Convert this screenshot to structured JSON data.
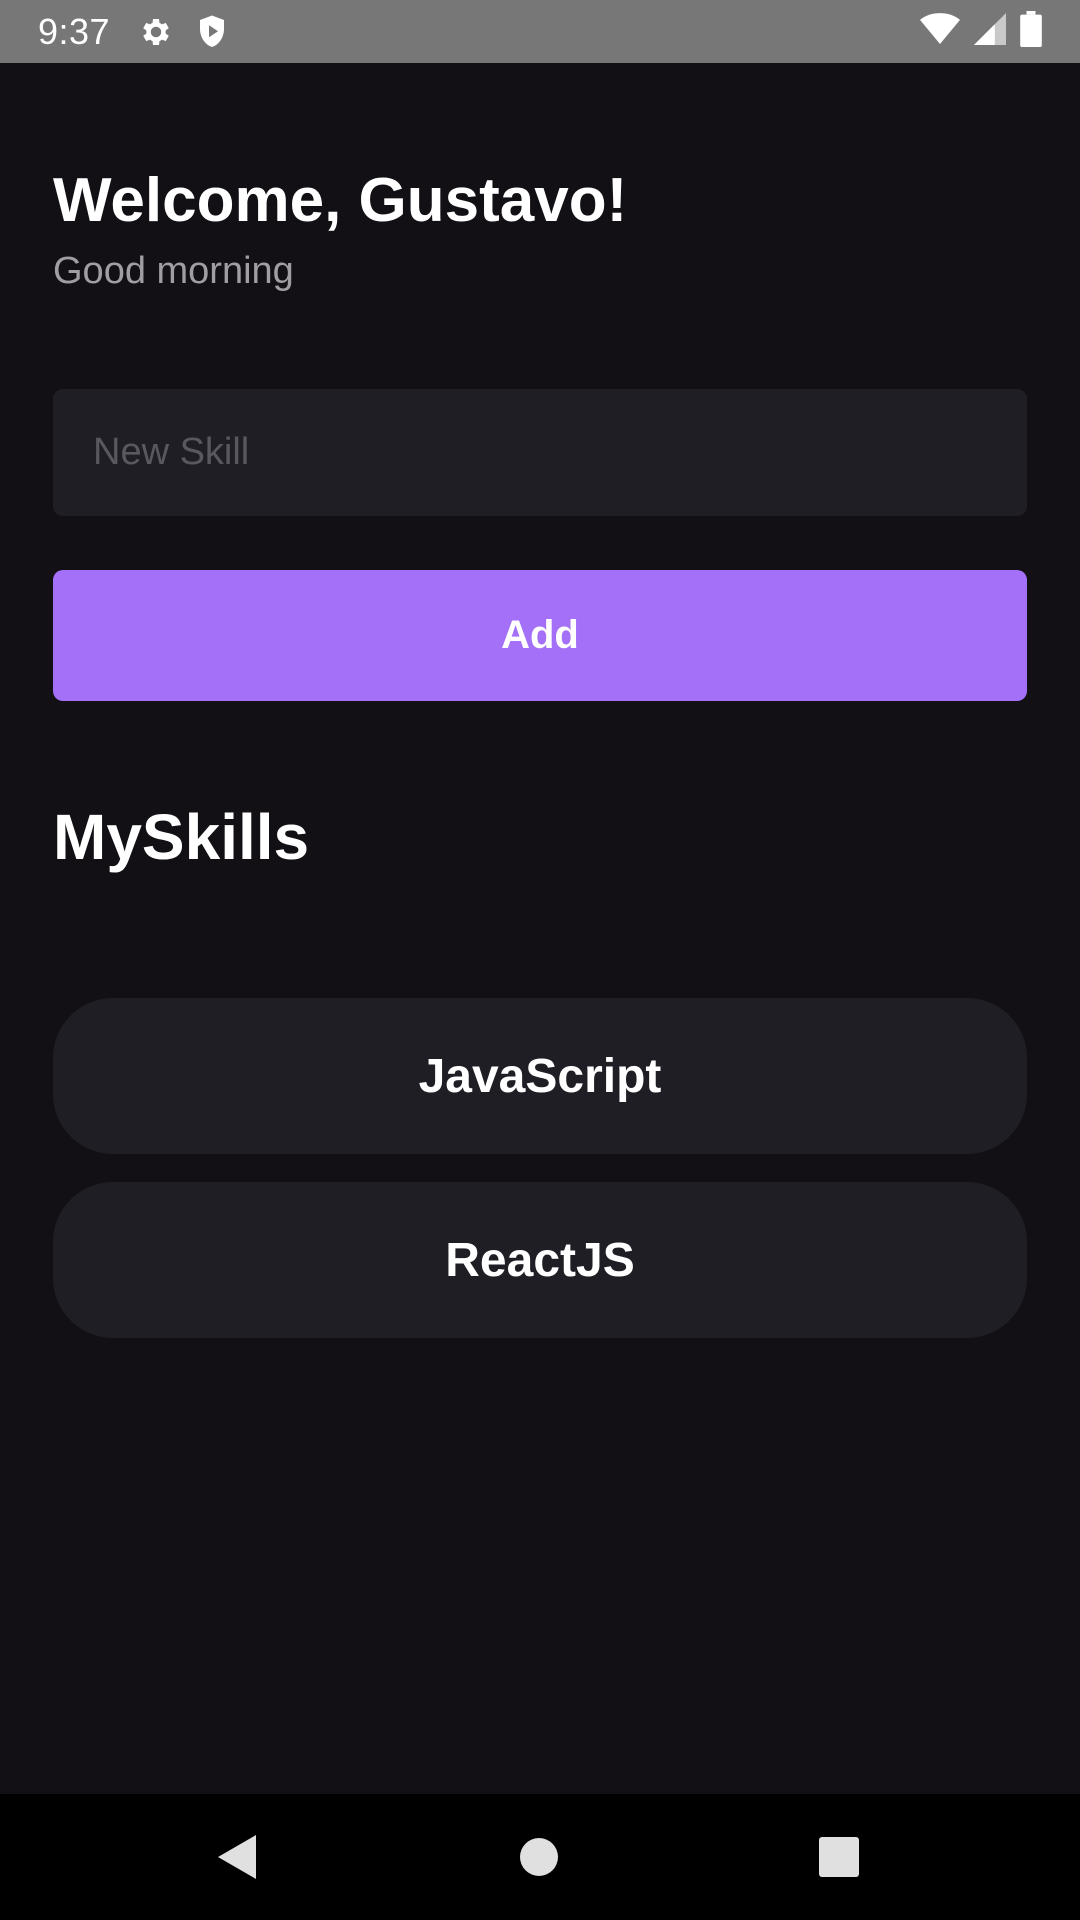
{
  "status_bar": {
    "time": "9:37",
    "icons_left": [
      "gear-icon",
      "shield-play-icon"
    ],
    "icons_right": [
      "wifi-icon",
      "cellular-signal-icon",
      "battery-icon"
    ]
  },
  "header": {
    "welcome": "Welcome, Gustavo!",
    "greeting": "Good morning"
  },
  "form": {
    "input_placeholder": "New Skill",
    "input_value": "",
    "add_label": "Add"
  },
  "skills_section": {
    "title": "MySkills",
    "items": [
      {
        "label": "JavaScript"
      },
      {
        "label": "ReactJS"
      }
    ]
  },
  "nav_bar": {
    "buttons": [
      "back-icon",
      "home-icon",
      "recents-icon"
    ]
  },
  "colors": {
    "background": "#121015",
    "card": "#1f1e25",
    "accent": "#a370f7",
    "status_bar": "#777777",
    "greeting_text": "#a09ea4"
  }
}
